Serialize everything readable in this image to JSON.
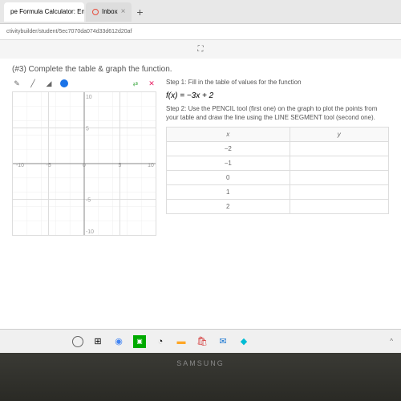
{
  "browser": {
    "tabs": [
      {
        "title": "pe Formula Calculator: Enter",
        "active": true
      },
      {
        "title": "Inbox",
        "active": false
      }
    ],
    "url": "ctivitybuilder/student/5ec7070da074d33d612d20af"
  },
  "page": {
    "title": "(#3) Complete the table & graph the function.",
    "step1": "Step 1: Fill in the table of values for the function",
    "formula": "f(x) = −3x + 2",
    "step2": "Step 2: Use the PENCIL tool (first one) on the graph to plot the points from your table and draw the line using the LINE SEGMENT tool (second one)."
  },
  "chart_data": {
    "type": "table",
    "columns": [
      "x",
      "y"
    ],
    "rows": [
      {
        "x": "−2",
        "y": ""
      },
      {
        "x": "−1",
        "y": ""
      },
      {
        "x": "0",
        "y": ""
      },
      {
        "x": "1",
        "y": ""
      },
      {
        "x": "2",
        "y": ""
      }
    ],
    "graph": {
      "xlim": [
        -10,
        10
      ],
      "ylim": [
        -10,
        10
      ],
      "xticks": [
        -10,
        -5,
        0,
        5,
        10
      ],
      "yticks": [
        -10,
        -5,
        5,
        10
      ]
    }
  },
  "taskbar": {
    "caret": "^"
  },
  "laptop": {
    "brand": "SAMSUNG"
  }
}
